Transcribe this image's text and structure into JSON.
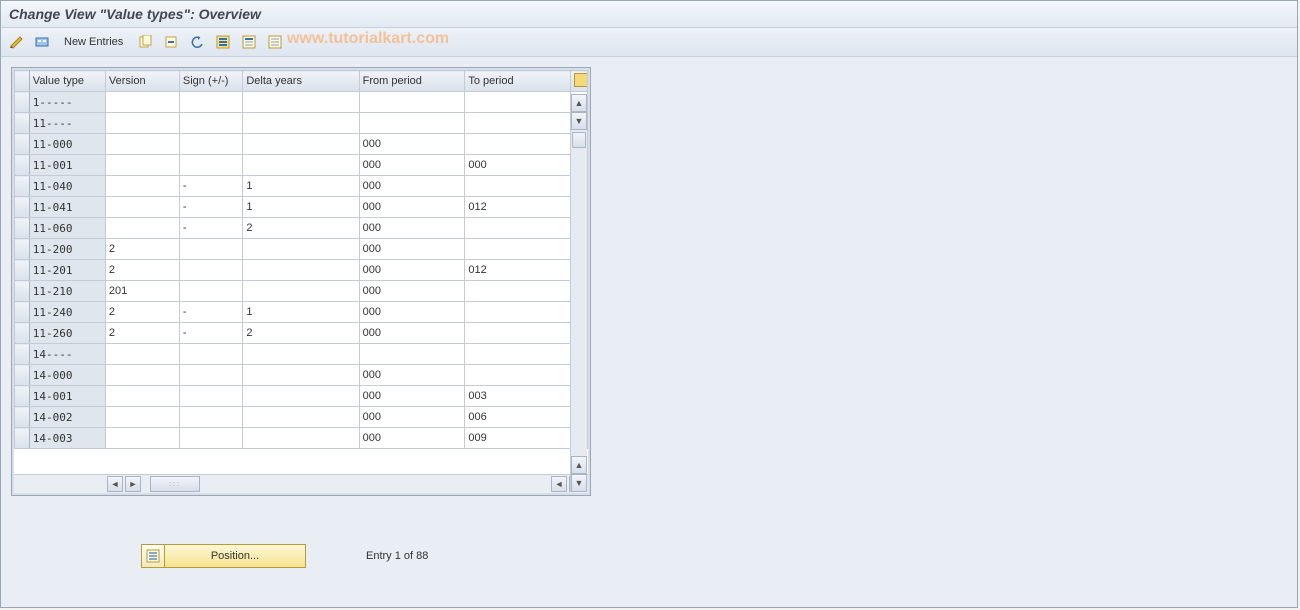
{
  "title": "Change View \"Value types\": Overview",
  "toolbar": {
    "new_entries": "New Entries"
  },
  "watermark": "www.tutorialkart.com",
  "columns": {
    "value_type": "Value type",
    "version": "Version",
    "sign": "Sign (+/-)",
    "delta": "Delta years",
    "from": "From period",
    "to": "To period"
  },
  "rows": [
    {
      "value_type": "1-----",
      "version": "",
      "sign": "",
      "delta": "",
      "from": "",
      "to": ""
    },
    {
      "value_type": "11----",
      "version": "",
      "sign": "",
      "delta": "",
      "from": "",
      "to": ""
    },
    {
      "value_type": "11-000",
      "version": "",
      "sign": "",
      "delta": "",
      "from": "000",
      "to": ""
    },
    {
      "value_type": "11-001",
      "version": "",
      "sign": "",
      "delta": "",
      "from": "000",
      "to": "000"
    },
    {
      "value_type": "11-040",
      "version": "",
      "sign": "-",
      "delta": "1",
      "from": "000",
      "to": ""
    },
    {
      "value_type": "11-041",
      "version": "",
      "sign": "-",
      "delta": "1",
      "from": "000",
      "to": "012"
    },
    {
      "value_type": "11-060",
      "version": "",
      "sign": "-",
      "delta": "2",
      "from": "000",
      "to": ""
    },
    {
      "value_type": "11-200",
      "version": "2",
      "sign": "",
      "delta": "",
      "from": "000",
      "to": ""
    },
    {
      "value_type": "11-201",
      "version": "2",
      "sign": "",
      "delta": "",
      "from": "000",
      "to": "012"
    },
    {
      "value_type": "11-210",
      "version": "201",
      "sign": "",
      "delta": "",
      "from": "000",
      "to": ""
    },
    {
      "value_type": "11-240",
      "version": "2",
      "sign": "-",
      "delta": "1",
      "from": "000",
      "to": ""
    },
    {
      "value_type": "11-260",
      "version": "2",
      "sign": "-",
      "delta": "2",
      "from": "000",
      "to": ""
    },
    {
      "value_type": "14----",
      "version": "",
      "sign": "",
      "delta": "",
      "from": "",
      "to": ""
    },
    {
      "value_type": "14-000",
      "version": "",
      "sign": "",
      "delta": "",
      "from": "000",
      "to": ""
    },
    {
      "value_type": "14-001",
      "version": "",
      "sign": "",
      "delta": "",
      "from": "000",
      "to": "003"
    },
    {
      "value_type": "14-002",
      "version": "",
      "sign": "",
      "delta": "",
      "from": "000",
      "to": "006"
    },
    {
      "value_type": "14-003",
      "version": "",
      "sign": "",
      "delta": "",
      "from": "000",
      "to": "009"
    }
  ],
  "footer": {
    "position_label": "Position...",
    "entry_text": "Entry 1 of 88"
  }
}
